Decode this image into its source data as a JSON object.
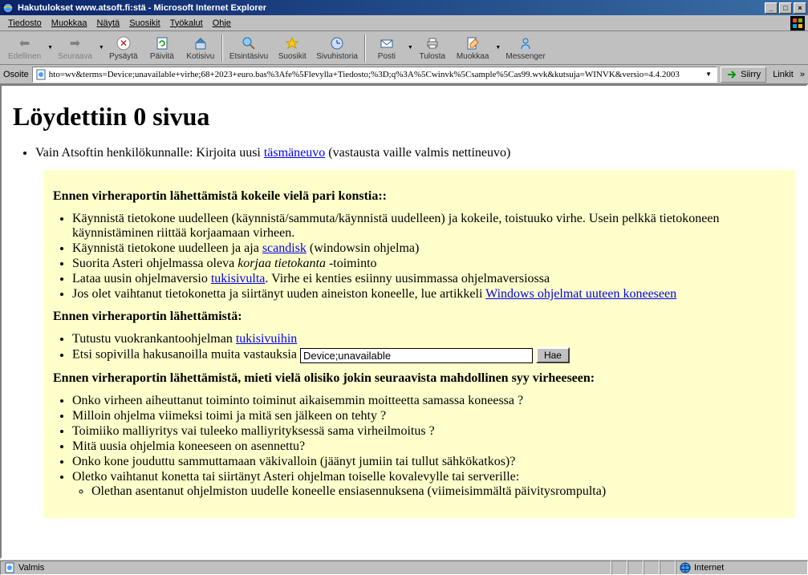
{
  "window": {
    "title": "Hakutulokset www.atsoft.fi:stä - Microsoft Internet Explorer"
  },
  "menu": {
    "items": [
      "Tiedosto",
      "Muokkaa",
      "Näytä",
      "Suosikit",
      "Työkalut",
      "Ohje"
    ]
  },
  "toolbar": {
    "back": "Edellinen",
    "forward": "Seuraava",
    "stop": "Pysäytä",
    "refresh": "Päivitä",
    "home": "Kotisivu",
    "search": "Etsintäsivu",
    "favorites": "Suosikit",
    "history": "Sivuhistoria",
    "mail": "Posti",
    "print": "Tulosta",
    "edit": "Muokkaa",
    "messenger": "Messenger"
  },
  "address": {
    "label": "Osoite",
    "url": "hto=wv&terms=Device;unavailable+virhe;68+2023+euro.bas%3Afe%5Flevylla+Tiedosto;%3D;q%3A%5Cwinvk%5Csample%5Cas99.wvk&kutsuja=WINVK&versio=4.4.2003",
    "go": "Siirry",
    "links": "Linkit"
  },
  "page": {
    "heading": "Löydettiin 0 sivua",
    "intro_text": "Vain Atsoftin henkilökunnalle: Kirjoita uusi ",
    "intro_link": "täsmäneuvo",
    "intro_suffix": " (vastausta vaille valmis nettineuvo)",
    "sec1_head": "Ennen virheraportin lähettämistä kokeile vielä pari konstia:",
    "s1_i1": "Käynnistä tietokone uudelleen (käynnistä/sammuta/käynnistä uudelleen) ja kokeile, toistuuko virhe. Usein pelkkä tietokoneen käynnistäminen riittää korjaamaan virheen.",
    "s1_i2a": "Käynnistä tietokone uudelleen ja aja ",
    "s1_i2_link": "scandisk",
    "s1_i2b": " (windowsin ohjelma)",
    "s1_i3a": "Suorita Asteri ohjelmassa oleva ",
    "s1_i3_em": "korjaa tietokanta",
    "s1_i3b": " -toiminto",
    "s1_i4a": "Lataa uusin ohjelmaversio ",
    "s1_i4_link": "tukisivulta",
    "s1_i4b": ". Virhe ei kenties esiinny uusimmassa ohjelmaversiossa",
    "s1_i5a": "Jos olet vaihtanut tietokonetta ja siirtänyt uuden aineiston koneelle, lue artikkeli ",
    "s1_i5_link": "Windows ohjelmat uuteen koneeseen",
    "sec2_head": "Ennen virheraportin lähettämistä:",
    "s2_i1a": "Tutustu vuokrankantoohjelman ",
    "s2_i1_link": "tukisivuihin",
    "s2_i2": "Etsi sopivilla hakusanoilla muita vastauksia ",
    "search_value": "Device;unavailable",
    "search_btn": "Hae",
    "sec3_head": "Ennen virheraportin lähettämistä, mieti vielä olisiko jokin seuraavista mahdollinen syy virheeseen:",
    "s3_i1": "Onko virheen aiheuttanut toiminto toiminut aikaisemmin moitteetta samassa koneessa ?",
    "s3_i2": "Milloin ohjelma viimeksi toimi ja mitä sen jälkeen on tehty ?",
    "s3_i3": "Toimiiko malliyritys vai tuleeko malliyrityksessä sama virheilmoitus ?",
    "s3_i4": "Mitä uusia ohjelmia koneeseen on asennettu?",
    "s3_i5": "Onko kone jouduttu sammuttamaan väkivalloin (jäänyt jumiin tai tullut sähkökatkos)?",
    "s3_i6": "Oletko vaihtanut konetta tai siirtänyt Asteri ohjelman toiselle kovalevylle tai serverille:",
    "s3_i6_sub1": "Olethan asentanut ohjelmiston uudelle koneelle ensiasennuksena (viimeisimmältä päivitysrompulta)"
  },
  "status": {
    "ready": "Valmis",
    "zone": "Internet"
  }
}
